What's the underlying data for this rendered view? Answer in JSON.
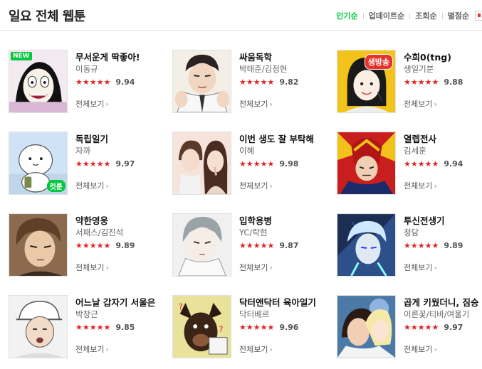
{
  "header": {
    "title": "일요 전체 웹툰",
    "sort_tabs": [
      "인기순",
      "업데이트순",
      "조회순",
      "별점순"
    ],
    "active_sort": "인기순"
  },
  "more_label": "전체보기",
  "stars": "★★★★★",
  "colors": {
    "accent_green": "#00c73c",
    "star_red": "#e02323"
  },
  "webtoons": [
    {
      "title": "무서운게 딱좋아!",
      "author": "이동규",
      "score": "9.94",
      "badge": "NEW",
      "badge_color": "#00c73c"
    },
    {
      "title": "싸움독학",
      "author": "박태준/김정현",
      "score": "9.82"
    },
    {
      "title": "수희0(tng)",
      "author": "생일기분",
      "score": "9.88",
      "badge": "생방송",
      "badge_color": "#e8332a"
    },
    {
      "title": "독립일기",
      "author": "자까",
      "score": "9.97",
      "badge": "컷툰",
      "badge_color": "#00c73c"
    },
    {
      "title": "이번 생도 잘 부탁해",
      "author": "이혜",
      "score": "9.98"
    },
    {
      "title": "열렙전사",
      "author": "김세훈",
      "score": "9.94"
    },
    {
      "title": "약한영웅",
      "author": "서패스/김진석",
      "score": "9.89"
    },
    {
      "title": "입학용병",
      "author": "YC/락현",
      "score": "9.87"
    },
    {
      "title": "투신전생기",
      "author": "청담",
      "score": "9.89"
    },
    {
      "title": "어느날 갑자기 서울은",
      "author": "박창근",
      "score": "9.85"
    },
    {
      "title": "닥터앤닥터 육아일기",
      "author": "닥터베르",
      "score": "9.96"
    },
    {
      "title": "곱게 키웠더니, 짐승",
      "author": "이른꽃/티바/여울기",
      "score": "9.97"
    }
  ]
}
